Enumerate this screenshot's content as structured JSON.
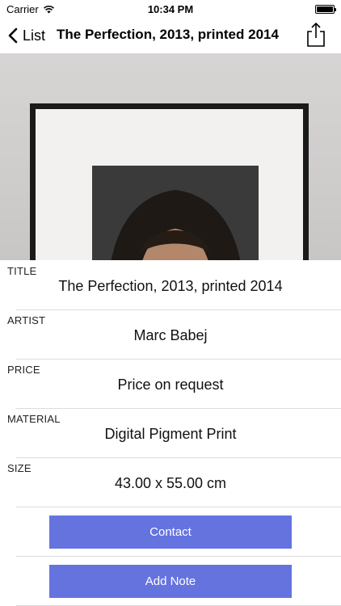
{
  "status_bar": {
    "carrier": "Carrier",
    "time": "10:34 PM",
    "icons": [
      "wifi-icon",
      "battery-icon"
    ]
  },
  "nav": {
    "back_label": "List",
    "title": "The Perfection, 2013, printed 2014",
    "icons": [
      "chevron-left-icon",
      "share-icon"
    ]
  },
  "details": {
    "title": {
      "label": "TITLE",
      "value": "The Perfection, 2013, printed 2014"
    },
    "artist": {
      "label": "ARTIST",
      "value": "Marc Babej"
    },
    "price": {
      "label": "PRICE",
      "value": "Price on request"
    },
    "material": {
      "label": "MATERIAL",
      "value": "Digital Pigment Print"
    },
    "size": {
      "label": "SIZE",
      "value": "43.00 x 55.00 cm"
    }
  },
  "actions": {
    "contact_label": "Contact",
    "add_note_label": "Add Note"
  },
  "colors": {
    "button": "#6573df",
    "separator": "#dcdcdc"
  }
}
